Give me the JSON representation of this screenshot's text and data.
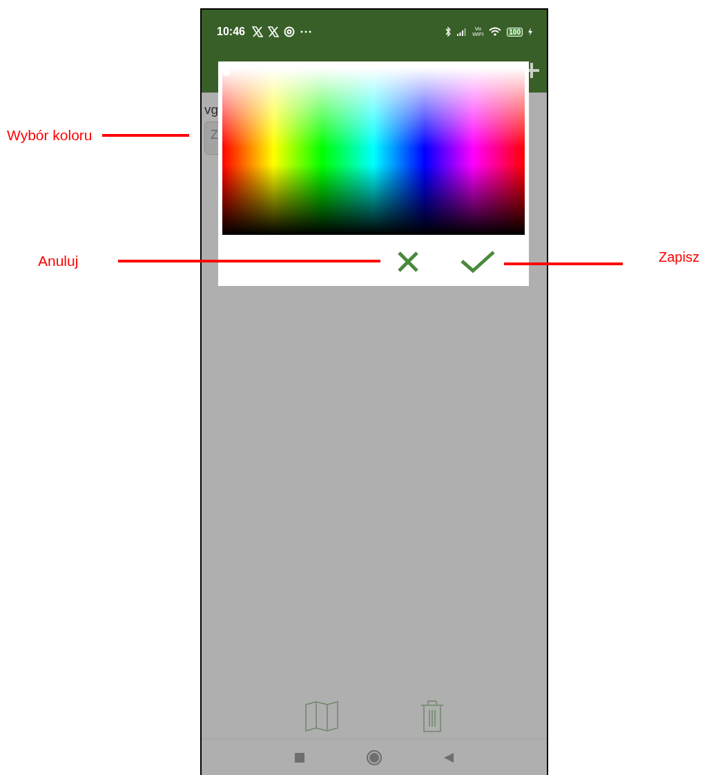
{
  "status_bar": {
    "time": "10:46",
    "network_label": [
      "Vo",
      "WiFi"
    ],
    "battery": "100"
  },
  "screen": {
    "label": "vg",
    "field_value": "Z"
  },
  "color_dialog": {
    "buttons": [
      {
        "kind": "cancel"
      },
      {
        "kind": "confirm"
      }
    ]
  },
  "annotations": [
    {
      "text": "Wybór koloru"
    },
    {
      "text": "Anuluj"
    },
    {
      "text": "Zapisz"
    }
  ]
}
